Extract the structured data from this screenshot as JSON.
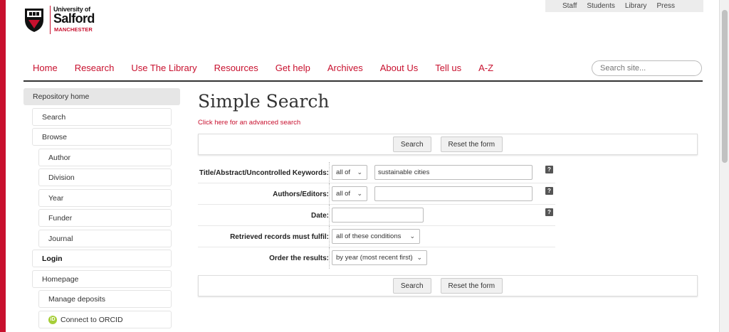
{
  "utility_nav": [
    "Staff",
    "Students",
    "Library",
    "Press"
  ],
  "logo": {
    "line1": "University of",
    "line2": "Salford",
    "line3": "MANCHESTER"
  },
  "main_nav": [
    "Home",
    "Research",
    "Use The Library",
    "Resources",
    "Get help",
    "Archives",
    "About Us",
    "Tell us",
    "A-Z"
  ],
  "site_search": {
    "placeholder": "Search site..."
  },
  "sidebar": {
    "header": "Repository home",
    "items": [
      {
        "label": "Search"
      },
      {
        "label": "Browse"
      },
      {
        "label": "Author"
      },
      {
        "label": "Division"
      },
      {
        "label": "Year"
      },
      {
        "label": "Funder"
      },
      {
        "label": "Journal"
      },
      {
        "label": "Login"
      },
      {
        "label": "Homepage"
      },
      {
        "label": "Manage deposits"
      },
      {
        "label": "Connect to ORCID"
      }
    ]
  },
  "page": {
    "title": "Simple Search",
    "advanced_link": "Click here for an advanced search",
    "search_button": "Search",
    "reset_button": "Reset the form"
  },
  "form": {
    "keywords": {
      "label": "Title/Abstract/Uncontrolled Keywords:",
      "match": "all of",
      "value": "sustainable cities"
    },
    "authors": {
      "label": "Authors/Editors:",
      "match": "all of",
      "value": ""
    },
    "date": {
      "label": "Date:",
      "value": ""
    },
    "retrieved": {
      "label": "Retrieved records must fulfil:",
      "value": "all of these conditions"
    },
    "order": {
      "label": "Order the results:",
      "value": "by year (most recent first)"
    },
    "help_glyph": "?"
  },
  "icons": {
    "orcid": "iD"
  },
  "colors": {
    "brand_red": "#c8102e"
  }
}
